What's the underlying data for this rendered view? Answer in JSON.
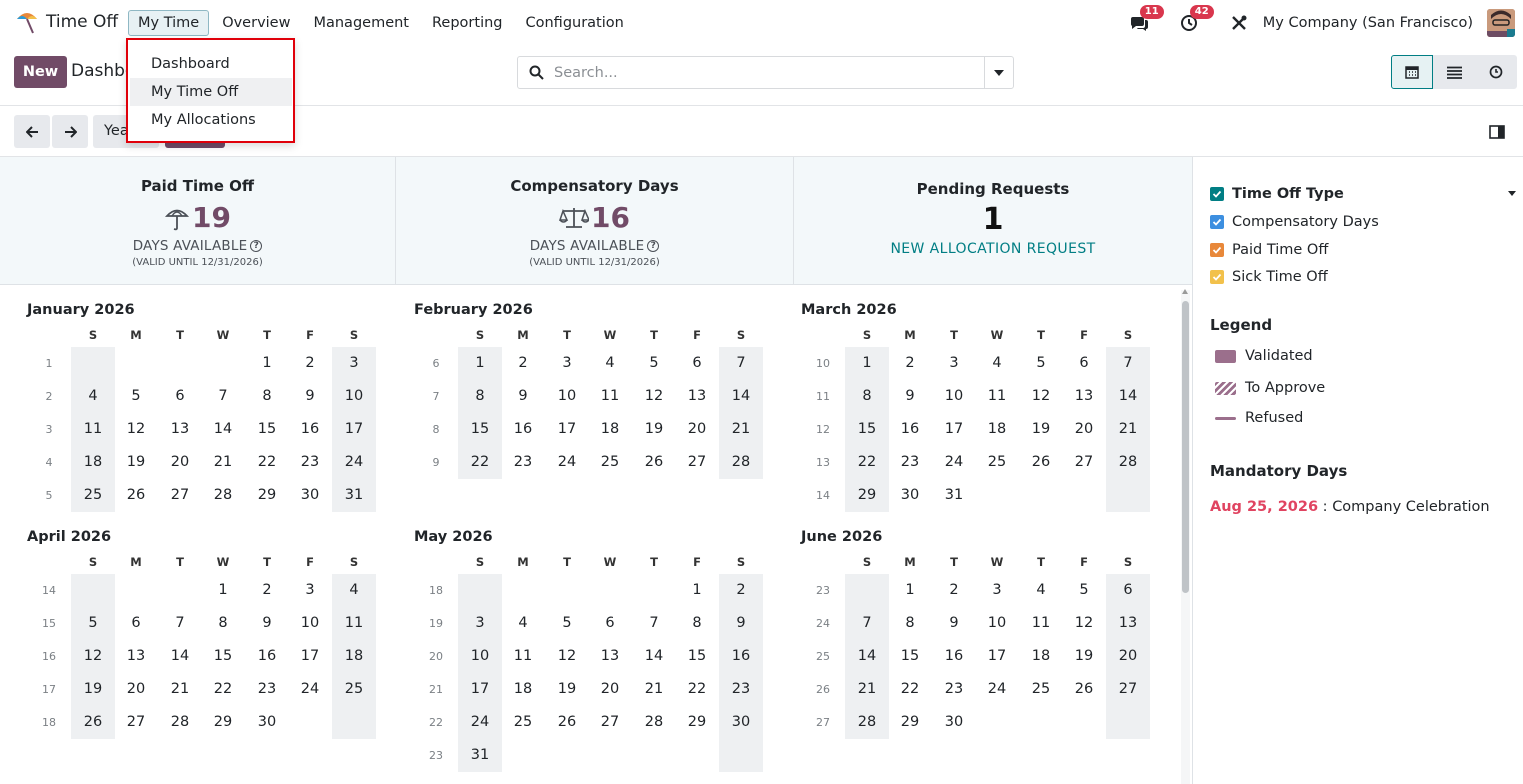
{
  "app": {
    "name": "Time Off"
  },
  "menu": {
    "items": [
      "My Time",
      "Overview",
      "Management",
      "Reporting",
      "Configuration"
    ]
  },
  "systray": {
    "messages_count": "11",
    "activities_count": "42",
    "company": "My Company (San Francisco)"
  },
  "control": {
    "new_label": "New",
    "breadcrumb": "Dashboard",
    "search_placeholder": "Search...",
    "scale_label": "Year"
  },
  "dropdown": {
    "items": [
      "Dashboard",
      "My Time Off",
      "My Allocations"
    ]
  },
  "stats": {
    "paid": {
      "title": "Paid Time Off",
      "value": "19",
      "sub": "DAYS AVAILABLE",
      "valid": "(VALID UNTIL 12/31/2026)"
    },
    "comp": {
      "title": "Compensatory Days",
      "value": "16",
      "sub": "DAYS AVAILABLE",
      "valid": "(VALID UNTIL 12/31/2026)"
    },
    "pending": {
      "title": "Pending Requests",
      "value": "1",
      "link": "NEW ALLOCATION REQUEST"
    }
  },
  "calendar": {
    "weekday_labels": [
      "S",
      "M",
      "T",
      "W",
      "T",
      "F",
      "S"
    ],
    "months": [
      {
        "title": "January 2026",
        "weeks": [
          {
            "wk": "1",
            "days": [
              "",
              "",
              "",
              "",
              "1",
              "2",
              "3"
            ]
          },
          {
            "wk": "2",
            "days": [
              "4",
              "5",
              "6",
              "7",
              "8",
              "9",
              "10"
            ]
          },
          {
            "wk": "3",
            "days": [
              "11",
              "12",
              "13",
              "14",
              "15",
              "16",
              "17"
            ]
          },
          {
            "wk": "4",
            "days": [
              "18",
              "19",
              "20",
              "21",
              "22",
              "23",
              "24"
            ]
          },
          {
            "wk": "5",
            "days": [
              "25",
              "26",
              "27",
              "28",
              "29",
              "30",
              "31"
            ]
          }
        ]
      },
      {
        "title": "February 2026",
        "weeks": [
          {
            "wk": "6",
            "days": [
              "1",
              "2",
              "3",
              "4",
              "5",
              "6",
              "7"
            ]
          },
          {
            "wk": "7",
            "days": [
              "8",
              "9",
              "10",
              "11",
              "12",
              "13",
              "14"
            ]
          },
          {
            "wk": "8",
            "days": [
              "15",
              "16",
              "17",
              "18",
              "19",
              "20",
              "21"
            ]
          },
          {
            "wk": "9",
            "days": [
              "22",
              "23",
              "24",
              "25",
              "26",
              "27",
              "28"
            ]
          }
        ]
      },
      {
        "title": "March 2026",
        "weeks": [
          {
            "wk": "10",
            "days": [
              "1",
              "2",
              "3",
              "4",
              "5",
              "6",
              "7"
            ]
          },
          {
            "wk": "11",
            "days": [
              "8",
              "9",
              "10",
              "11",
              "12",
              "13",
              "14"
            ]
          },
          {
            "wk": "12",
            "days": [
              "15",
              "16",
              "17",
              "18",
              "19",
              "20",
              "21"
            ]
          },
          {
            "wk": "13",
            "days": [
              "22",
              "23",
              "24",
              "25",
              "26",
              "27",
              "28"
            ]
          },
          {
            "wk": "14",
            "days": [
              "29",
              "30",
              "31",
              "",
              "",
              "",
              ""
            ]
          }
        ]
      },
      {
        "title": "April 2026",
        "weeks": [
          {
            "wk": "14",
            "days": [
              "",
              "",
              "",
              "1",
              "2",
              "3",
              "4"
            ]
          },
          {
            "wk": "15",
            "days": [
              "5",
              "6",
              "7",
              "8",
              "9",
              "10",
              "11"
            ]
          },
          {
            "wk": "16",
            "days": [
              "12",
              "13",
              "14",
              "15",
              "16",
              "17",
              "18"
            ]
          },
          {
            "wk": "17",
            "days": [
              "19",
              "20",
              "21",
              "22",
              "23",
              "24",
              "25"
            ]
          },
          {
            "wk": "18",
            "days": [
              "26",
              "27",
              "28",
              "29",
              "30",
              "",
              ""
            ]
          }
        ]
      },
      {
        "title": "May 2026",
        "weeks": [
          {
            "wk": "18",
            "days": [
              "",
              "",
              "",
              "",
              "",
              "1",
              "2"
            ]
          },
          {
            "wk": "19",
            "days": [
              "3",
              "4",
              "5",
              "6",
              "7",
              "8",
              "9"
            ]
          },
          {
            "wk": "20",
            "days": [
              "10",
              "11",
              "12",
              "13",
              "14",
              "15",
              "16"
            ]
          },
          {
            "wk": "21",
            "days": [
              "17",
              "18",
              "19",
              "20",
              "21",
              "22",
              "23"
            ]
          },
          {
            "wk": "22",
            "days": [
              "24",
              "25",
              "26",
              "27",
              "28",
              "29",
              "30"
            ]
          },
          {
            "wk": "23",
            "days": [
              "31",
              "",
              "",
              "",
              "",
              "",
              ""
            ]
          }
        ]
      },
      {
        "title": "June 2026",
        "weeks": [
          {
            "wk": "23",
            "days": [
              "",
              "1",
              "2",
              "3",
              "4",
              "5",
              "6"
            ]
          },
          {
            "wk": "24",
            "days": [
              "7",
              "8",
              "9",
              "10",
              "11",
              "12",
              "13"
            ]
          },
          {
            "wk": "25",
            "days": [
              "14",
              "15",
              "16",
              "17",
              "18",
              "19",
              "20"
            ]
          },
          {
            "wk": "26",
            "days": [
              "21",
              "22",
              "23",
              "24",
              "25",
              "26",
              "27"
            ]
          },
          {
            "wk": "27",
            "days": [
              "28",
              "29",
              "30",
              "",
              "",
              "",
              ""
            ]
          }
        ]
      }
    ]
  },
  "filters": {
    "group_label": "Time Off Type",
    "items": [
      {
        "label": "Compensatory Days",
        "color": "#3d8fe0"
      },
      {
        "label": "Paid Time Off",
        "color": "#e8883a"
      },
      {
        "label": "Sick Time Off",
        "color": "#f2c14b"
      }
    ],
    "group_color": "#017e84"
  },
  "legend": {
    "heading": "Legend",
    "items": [
      "Validated",
      "To Approve",
      "Refused"
    ],
    "color": "#9b6f8c"
  },
  "mandatory": {
    "heading": "Mandatory Days",
    "date": "Aug 25, 2026",
    "separator": " : ",
    "name": "Company Celebration"
  },
  "colors": {
    "brand": "#714b67",
    "accent": "#017e84",
    "badge": "#d9364d",
    "dropdown_highlight": "#e0000a"
  }
}
